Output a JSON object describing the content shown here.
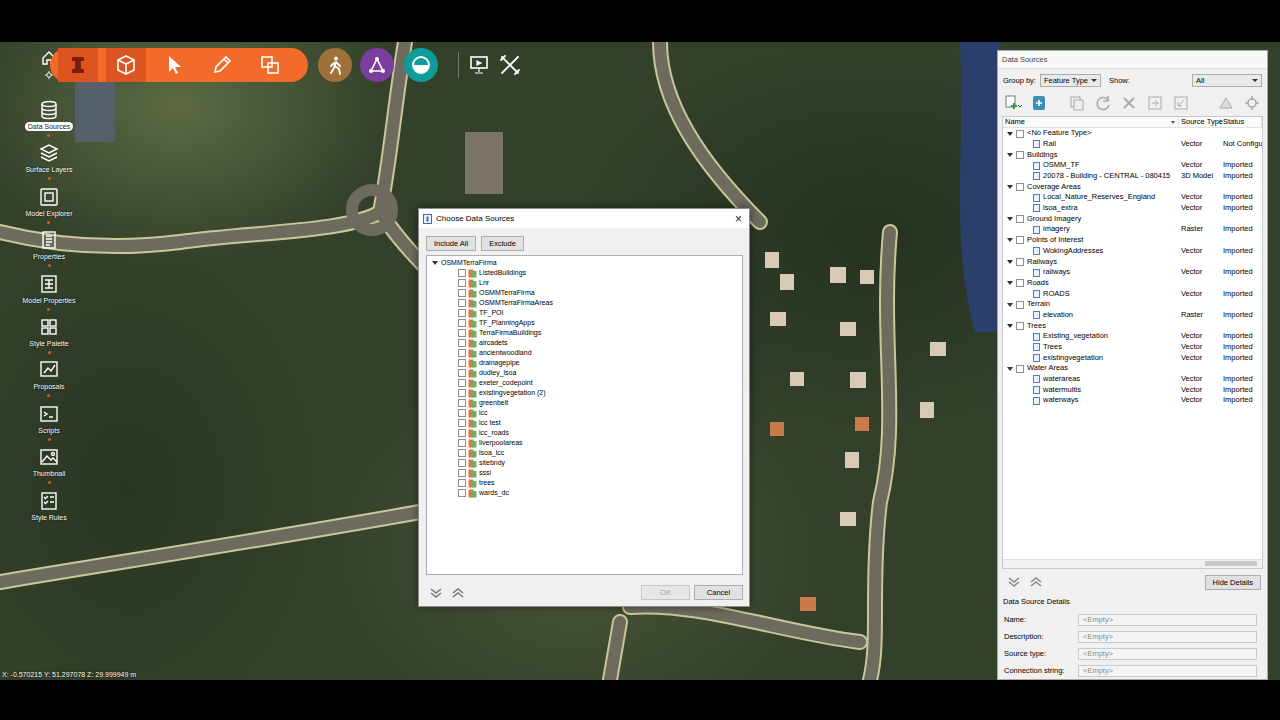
{
  "toolbar": {
    "tools": [
      {
        "selected": true
      },
      {
        "selected": true
      },
      {
        "selected": false
      },
      {
        "selected": false
      },
      {
        "selected": false
      }
    ]
  },
  "sidebar": {
    "items": [
      {
        "label": "Data Sources",
        "selected": true
      },
      {
        "label": "Surface Layers",
        "selected": false
      },
      {
        "label": "Model Explorer",
        "selected": false
      },
      {
        "label": "Properties",
        "selected": false
      },
      {
        "label": "Model Properties",
        "selected": false
      },
      {
        "label": "Style Palette",
        "selected": false
      },
      {
        "label": "Proposals",
        "selected": false
      },
      {
        "label": "Scripts",
        "selected": false
      },
      {
        "label": "Thumbnail",
        "selected": false
      },
      {
        "label": "Style Rules",
        "selected": false
      }
    ]
  },
  "dialog": {
    "title": "Choose Data Sources",
    "close": "×",
    "actions": [
      "Include All",
      "Exclude"
    ],
    "tree": {
      "root": "OSMMTerraFirma",
      "expanded": true,
      "items": [
        {
          "label": "ListedBuildings",
          "checked": false
        },
        {
          "label": "Lnr",
          "checked": false
        },
        {
          "label": "OSMMTerraFirma",
          "checked": false
        },
        {
          "label": "OSMMTerraFirmaAreas",
          "checked": false
        },
        {
          "label": "TF_POI",
          "checked": false
        },
        {
          "label": "TF_PlanningApps",
          "checked": false
        },
        {
          "label": "TerraFirmaBuildings",
          "checked": false
        },
        {
          "label": "aircadets",
          "checked": false
        },
        {
          "label": "ancientwoodland",
          "checked": false
        },
        {
          "label": "drainagepipe",
          "checked": false
        },
        {
          "label": "dudley_lsoa",
          "checked": false
        },
        {
          "label": "exeter_codepoint",
          "checked": false
        },
        {
          "label": "existingvegetation (2)",
          "checked": false
        },
        {
          "label": "greenbelt",
          "checked": false
        },
        {
          "label": "lcc",
          "checked": false
        },
        {
          "label": "lcc test",
          "checked": false
        },
        {
          "label": "lcc_roads",
          "checked": false
        },
        {
          "label": "liverpoolareas",
          "checked": false
        },
        {
          "label": "lsoa_lcc",
          "checked": false
        },
        {
          "label": "sitebndy",
          "checked": false
        },
        {
          "label": "sssi",
          "checked": false
        },
        {
          "label": "trees",
          "checked": false
        },
        {
          "label": "wards_dc",
          "checked": false
        }
      ]
    },
    "buttons": [
      {
        "label": "OK",
        "disabled": true
      },
      {
        "label": "Cancel",
        "disabled": false
      }
    ]
  },
  "panel": {
    "title": "Data Sources",
    "group_by": {
      "label": "Group by:",
      "value": "Feature Type"
    },
    "show": {
      "label": "Show:",
      "value": "All"
    },
    "columns": [
      "Name",
      "Source Type",
      "Status"
    ],
    "groups": [
      {
        "name": "<No Feature Type>",
        "expanded": true,
        "checked": false,
        "rows": [
          {
            "name": "Rail",
            "type": "Vector",
            "status": "Not Configu"
          }
        ]
      },
      {
        "name": "Buildings",
        "expanded": true,
        "checked": false,
        "rows": [
          {
            "name": "OSMM_TF",
            "type": "Vector",
            "status": "Imported"
          },
          {
            "name": "20078 - Building - CENTRAL - 080415",
            "type": "3D Model",
            "status": "Imported"
          }
        ]
      },
      {
        "name": "Coverage Areas",
        "expanded": true,
        "checked": false,
        "rows": [
          {
            "name": "Local_Nature_Reserves_England",
            "type": "Vector",
            "status": "Imported"
          },
          {
            "name": "lsoa_extra",
            "type": "Vector",
            "status": "Imported"
          }
        ]
      },
      {
        "name": "Ground Imagery",
        "expanded": true,
        "checked": false,
        "rows": [
          {
            "name": "imagery",
            "type": "Raster",
            "status": "Imported"
          }
        ]
      },
      {
        "name": "Points of Interest",
        "expanded": true,
        "checked": false,
        "rows": [
          {
            "name": "WokingAddresses",
            "type": "Vector",
            "status": "Imported"
          }
        ]
      },
      {
        "name": "Railways",
        "expanded": true,
        "checked": false,
        "rows": [
          {
            "name": "railways",
            "type": "Vector",
            "status": "Imported"
          }
        ]
      },
      {
        "name": "Roads",
        "expanded": true,
        "checked": false,
        "rows": [
          {
            "name": "ROADS",
            "type": "Vector",
            "status": "Imported"
          }
        ]
      },
      {
        "name": "Terrain",
        "expanded": true,
        "checked": false,
        "rows": [
          {
            "name": "elevation",
            "type": "Raster",
            "status": "Imported"
          }
        ]
      },
      {
        "name": "Trees",
        "expanded": true,
        "checked": false,
        "rows": [
          {
            "name": "Existing_vegetation",
            "type": "Vector",
            "status": "Imported"
          },
          {
            "name": "Trees",
            "type": "Vector",
            "status": "Imported"
          },
          {
            "name": "existingvegetation",
            "type": "Vector",
            "status": "Imported"
          }
        ]
      },
      {
        "name": "Water Areas",
        "expanded": true,
        "checked": false,
        "rows": [
          {
            "name": "waterareas",
            "type": "Vector",
            "status": "Imported"
          },
          {
            "name": "watermultis",
            "type": "Vector",
            "status": "Imported"
          },
          {
            "name": "waterways",
            "type": "Vector",
            "status": "Imported"
          }
        ]
      }
    ],
    "hide_details": "Hide Details",
    "details_title": "Data Source Details",
    "fields": [
      {
        "label": "Name:",
        "value": "<Empty>"
      },
      {
        "label": "Description:",
        "value": "<Empty>"
      },
      {
        "label": "Source type:",
        "value": "<Empty>"
      },
      {
        "label": "Connection string:",
        "value": "<Empty>"
      }
    ]
  },
  "status_bar": "X: -0.570215  Y: 51.297078  Z: 29.999949 m"
}
